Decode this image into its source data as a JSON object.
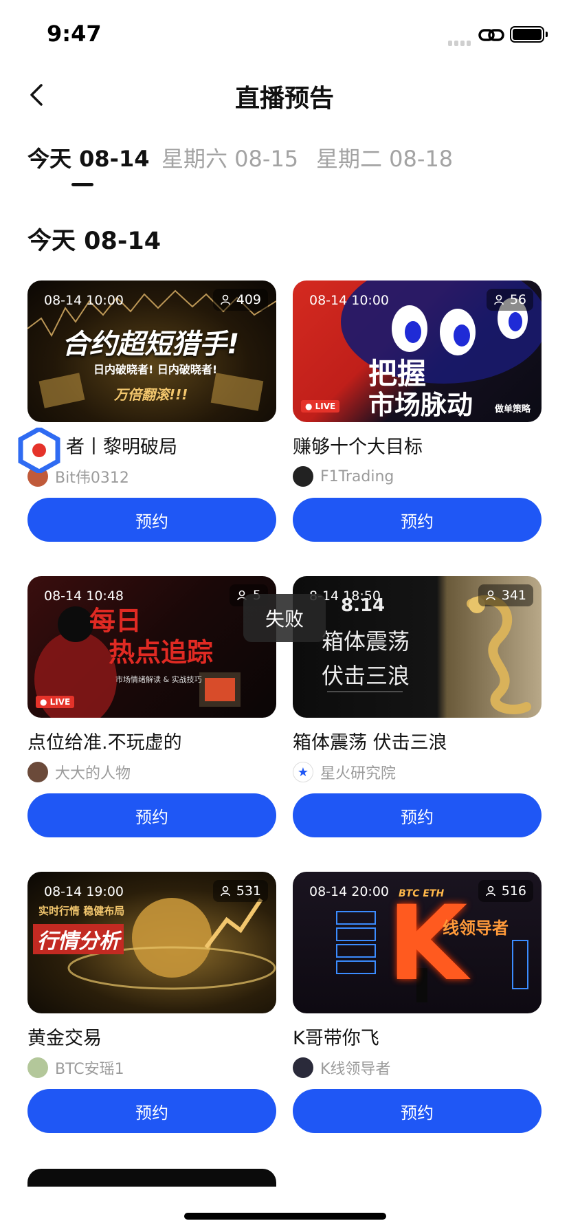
{
  "status_bar": {
    "time": "9:47"
  },
  "nav": {
    "title": "直播预告"
  },
  "tabs": [
    {
      "label": "今天 08-14",
      "active": true
    },
    {
      "label": "星期六 08-15",
      "active": false
    },
    {
      "label": "星期二 08-18",
      "active": false
    }
  ],
  "section": {
    "title": "今天 08-14"
  },
  "toast": {
    "text": "失败"
  },
  "cards": [
    {
      "datetime": "08-14 10:00",
      "viewers": "409",
      "live": "",
      "headline": "合约超短猎手!",
      "subhead": "日内破晓者! 日内破晓者!",
      "tagline": "万倍翻滚!!!",
      "title": "者丨黎明破局",
      "author": "Bit伟0312",
      "button": "预约"
    },
    {
      "datetime": "08-14 10:00",
      "viewers": "56",
      "live": "LIVE",
      "headline": "把握",
      "subhead": "市场脉动",
      "tagline": "做单策略",
      "title": "赚够十个大目标",
      "author": "F1Trading",
      "button": "预约"
    },
    {
      "datetime": "08-14 10:48",
      "viewers": "5",
      "live": "LIVE",
      "headline": "每日",
      "subhead": "热点追踪",
      "tagline": "市场情绪解读 & 实战技巧",
      "title": "点位给准.不玩虚的",
      "author": "大大的人物",
      "button": "预约"
    },
    {
      "datetime": "8-14 18:50",
      "viewers": "341",
      "live": "",
      "headline": "箱体震荡",
      "subhead": "伏击三浪",
      "tagline": "8.14",
      "title": "箱体震荡 伏击三浪",
      "author": "星火研究院",
      "button": "预约"
    },
    {
      "datetime": "08-14 19:00",
      "viewers": "531",
      "live": "",
      "headline": "行情分析",
      "subhead": "实时行情 稳健布局",
      "tagline": "",
      "title": "黄金交易",
      "author": "BTC安瑶1",
      "button": "预约"
    },
    {
      "datetime": "08-14 20:00",
      "viewers": "516",
      "live": "",
      "headline": "K",
      "subhead": "线领导者",
      "tagline": "BTC ETH",
      "title": "K哥带你飞",
      "author": "K线领导者",
      "button": "预约"
    }
  ]
}
